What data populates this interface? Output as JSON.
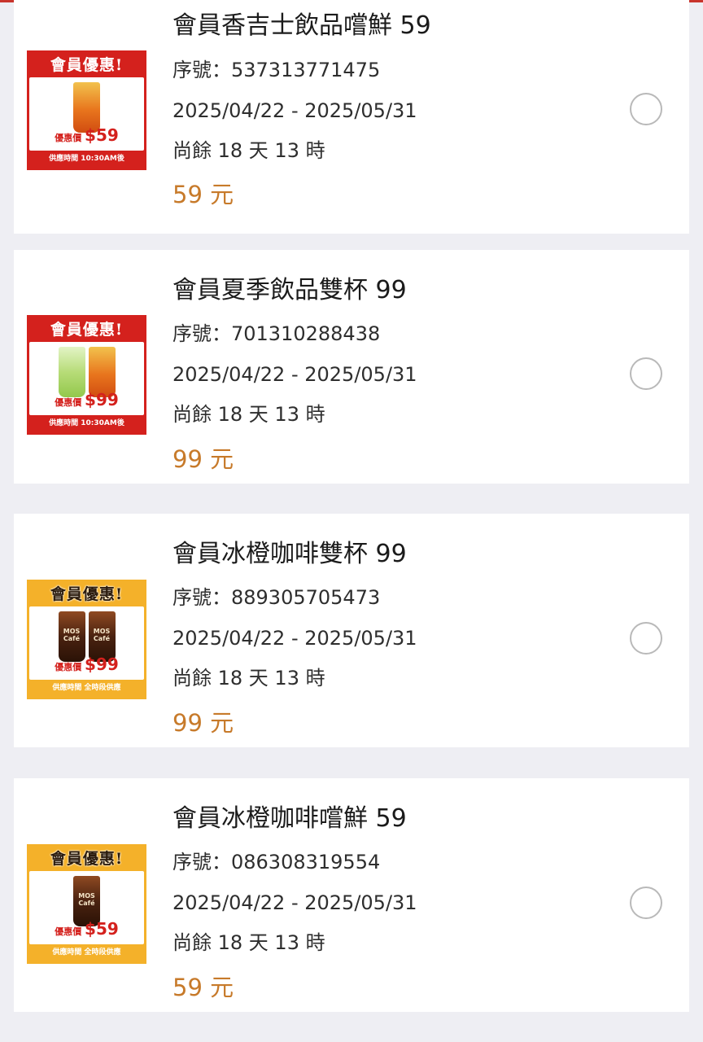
{
  "coupons": [
    {
      "title": "會員香吉士飲品嚐鮮 59",
      "serial": "序號：537313771475",
      "dates": "2025/04/22 - 2025/05/31",
      "remaining": "尚餘 18 天 13 時",
      "price": "59 元",
      "image": {
        "theme_color": "#d4211d",
        "header": "會員優惠!",
        "price_prefix": "優惠價",
        "price_value": "$59",
        "footer": "供應時間 10:30AM後",
        "cups": [
          "tea"
        ]
      }
    },
    {
      "title": "會員夏季飲品雙杯 99",
      "serial": "序號：701310288438",
      "dates": "2025/04/22 - 2025/05/31",
      "remaining": "尚餘 18 天 13 時",
      "price": "99 元",
      "image": {
        "theme_color": "#d4211d",
        "header": "會員優惠!",
        "price_prefix": "優惠價",
        "price_value": "$99",
        "footer": "供應時間 10:30AM後",
        "cups": [
          "green",
          "tea"
        ]
      }
    },
    {
      "title": "會員冰橙咖啡雙杯 99",
      "serial": "序號：889305705473",
      "dates": "2025/04/22 - 2025/05/31",
      "remaining": "尚餘 18 天 13 時",
      "price": "99 元",
      "image": {
        "theme_color": "#f4b12a",
        "header": "會員優惠!",
        "price_prefix": "優惠價",
        "price_value": "$99",
        "footer": "供應時間 全時段供應",
        "cups": [
          "coffee",
          "coffee"
        ],
        "cup_label": "MOS Café"
      }
    },
    {
      "title": "會員冰橙咖啡嚐鮮 59",
      "serial": "序號：086308319554",
      "dates": "2025/04/22 - 2025/05/31",
      "remaining": "尚餘 18 天 13 時",
      "price": "59 元",
      "image": {
        "theme_color": "#f4b12a",
        "header": "會員優惠!",
        "price_prefix": "優惠價",
        "price_value": "$59",
        "footer": "供應時間 全時段供應",
        "cups": [
          "coffee"
        ],
        "cup_label": "MOS Café"
      }
    }
  ],
  "radio_icon": "radio-unchecked-icon",
  "accent_color": "#c77a2a"
}
